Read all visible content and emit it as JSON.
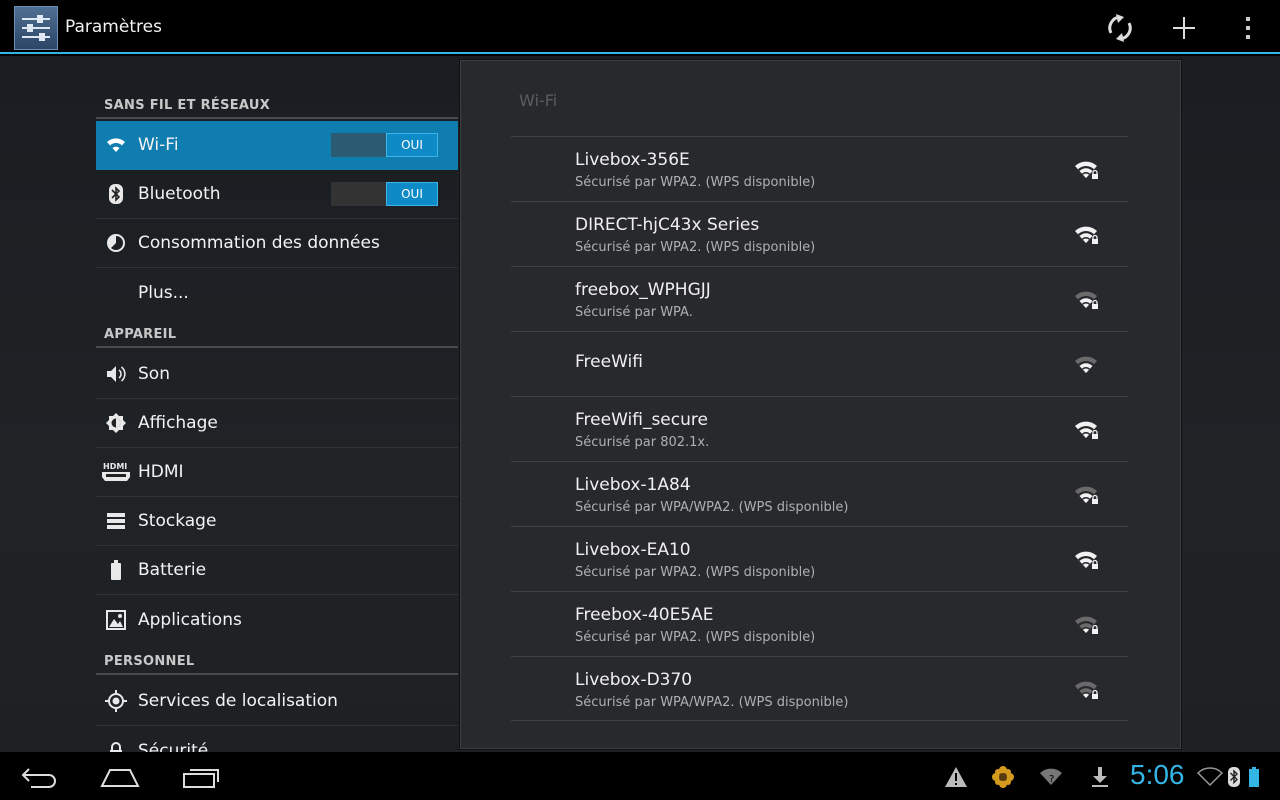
{
  "app": {
    "title": "Paramètres",
    "accent": "#33b5e5"
  },
  "actionbar": {
    "icons": [
      "sync-icon",
      "add-icon",
      "overflow-menu-icon"
    ]
  },
  "sidebar": {
    "sections": [
      {
        "header": "SANS FIL ET RÉSEAUX",
        "items": [
          {
            "label": "Wi-Fi",
            "icon": "wifi-icon",
            "toggle": "OUI",
            "selected": true
          },
          {
            "label": "Bluetooth",
            "icon": "bluetooth-icon",
            "toggle": "OUI"
          },
          {
            "label": "Consommation des données",
            "icon": "data-usage-icon"
          },
          {
            "label": "Plus...",
            "icon": ""
          }
        ]
      },
      {
        "header": "APPAREIL",
        "items": [
          {
            "label": "Son",
            "icon": "speaker-icon"
          },
          {
            "label": "Affichage",
            "icon": "brightness-icon"
          },
          {
            "label": "HDMI",
            "icon": "hdmi-icon"
          },
          {
            "label": "Stockage",
            "icon": "storage-icon"
          },
          {
            "label": "Batterie",
            "icon": "battery-icon"
          },
          {
            "label": "Applications",
            "icon": "apps-icon"
          }
        ]
      },
      {
        "header": "PERSONNEL",
        "items": [
          {
            "label": "Services de localisation",
            "icon": "location-icon"
          },
          {
            "label": "Sécurité",
            "icon": "lock-icon"
          }
        ]
      }
    ]
  },
  "panel": {
    "title": "Wi-Fi",
    "networks": [
      {
        "name": "Livebox-356E",
        "security": "Sécurisé par WPA2. (WPS disponible)",
        "locked": true,
        "strength": 4
      },
      {
        "name": "DIRECT-hjC43x Series",
        "security": "Sécurisé par WPA2. (WPS disponible)",
        "locked": true,
        "strength": 4
      },
      {
        "name": "freebox_WPHGJJ",
        "security": "Sécurisé par WPA.",
        "locked": true,
        "strength": 3
      },
      {
        "name": "FreeWifi",
        "security": "",
        "locked": false,
        "strength": 3
      },
      {
        "name": "FreeWifi_secure",
        "security": "Sécurisé par 802.1x.",
        "locked": true,
        "strength": 4
      },
      {
        "name": "Livebox-1A84",
        "security": "Sécurisé par WPA/WPA2. (WPS disponible)",
        "locked": true,
        "strength": 3
      },
      {
        "name": "Livebox-EA10",
        "security": "Sécurisé par WPA2. (WPS disponible)",
        "locked": true,
        "strength": 4
      },
      {
        "name": "Freebox-40E5AE",
        "security": "Sécurisé par WPA2. (WPS disponible)",
        "locked": true,
        "strength": 2
      },
      {
        "name": "Livebox-D370",
        "security": "Sécurisé par WPA/WPA2. (WPS disponible)",
        "locked": true,
        "strength": 2
      }
    ]
  },
  "navbar": {
    "buttons": [
      "back-icon",
      "home-icon",
      "recent-apps-icon"
    ],
    "status_icons": [
      "warning-icon",
      "flower-icon",
      "wifi-status-icon",
      "download-icon"
    ],
    "clock": "5:06",
    "right_icons": [
      "wifi-signal-icon",
      "bluetooth-status-icon",
      "battery-status-icon"
    ]
  }
}
